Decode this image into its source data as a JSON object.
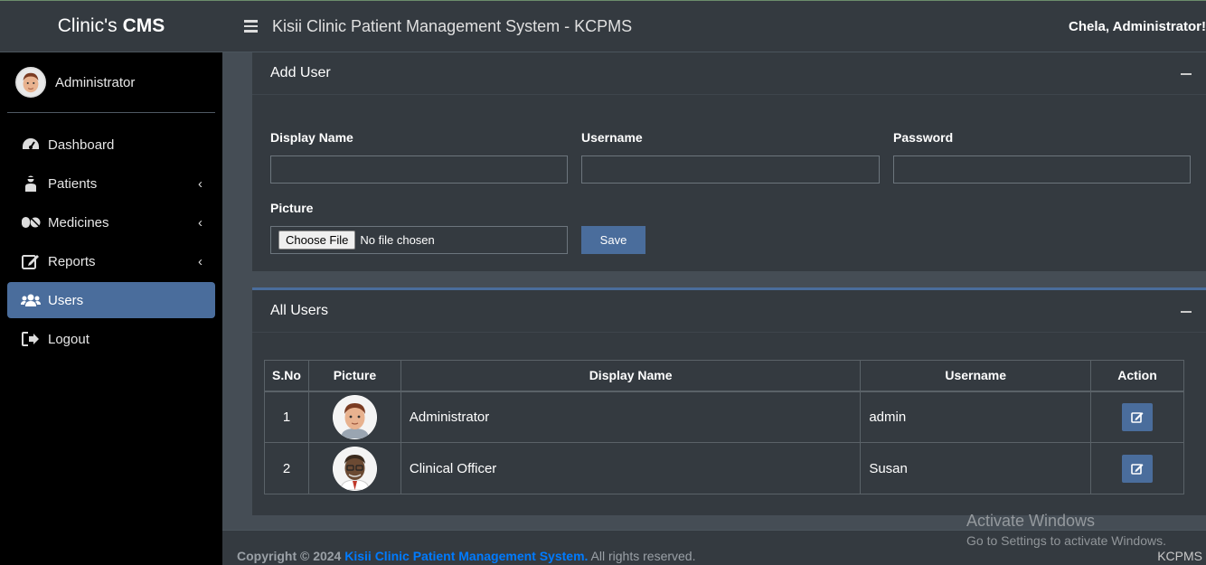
{
  "brand": {
    "light": "Clinic's",
    "bold": "CMS"
  },
  "user_panel": {
    "name": "Administrator"
  },
  "sidebar": {
    "items": [
      {
        "label": "Dashboard",
        "icon": "tachometer-icon"
      },
      {
        "label": "Patients",
        "icon": "user-injured-icon"
      },
      {
        "label": "Medicines",
        "icon": "pills-icon"
      },
      {
        "label": "Reports",
        "icon": "edit-icon"
      },
      {
        "label": "Users",
        "icon": "users-icon"
      },
      {
        "label": "Logout",
        "icon": "sign-out-icon"
      }
    ],
    "chevron": "‹"
  },
  "header": {
    "title": "Kisii Clinic Patient Management System - KCPMS",
    "user": "Chela, Administrator!"
  },
  "add_user": {
    "title": "Add User",
    "display_name_label": "Display Name",
    "username_label": "Username",
    "password_label": "Password",
    "picture_label": "Picture",
    "choose_file": "Choose File",
    "no_file": "No file chosen",
    "save": "Save"
  },
  "all_users": {
    "title": "All Users",
    "columns": [
      "S.No",
      "Picture",
      "Display Name",
      "Username",
      "Action"
    ],
    "rows": [
      {
        "sno": "1",
        "display_name": "Administrator",
        "username": "admin"
      },
      {
        "sno": "2",
        "display_name": "Clinical Officer",
        "username": "Susan"
      }
    ]
  },
  "footer": {
    "copyright_prefix": "Copyright © 2024",
    "system_link": "Kisii Clinic Patient Management System.",
    "rights": "All rights reserved.",
    "right_text": "KCPMS"
  },
  "watermark": {
    "line1": "Activate Windows",
    "line2": "Go to Settings to activate Windows."
  },
  "colors": {
    "accent": "#4a6d9c",
    "sidebar_bg": "#000000",
    "panel_bg": "#343a40",
    "link": "#007bff"
  }
}
